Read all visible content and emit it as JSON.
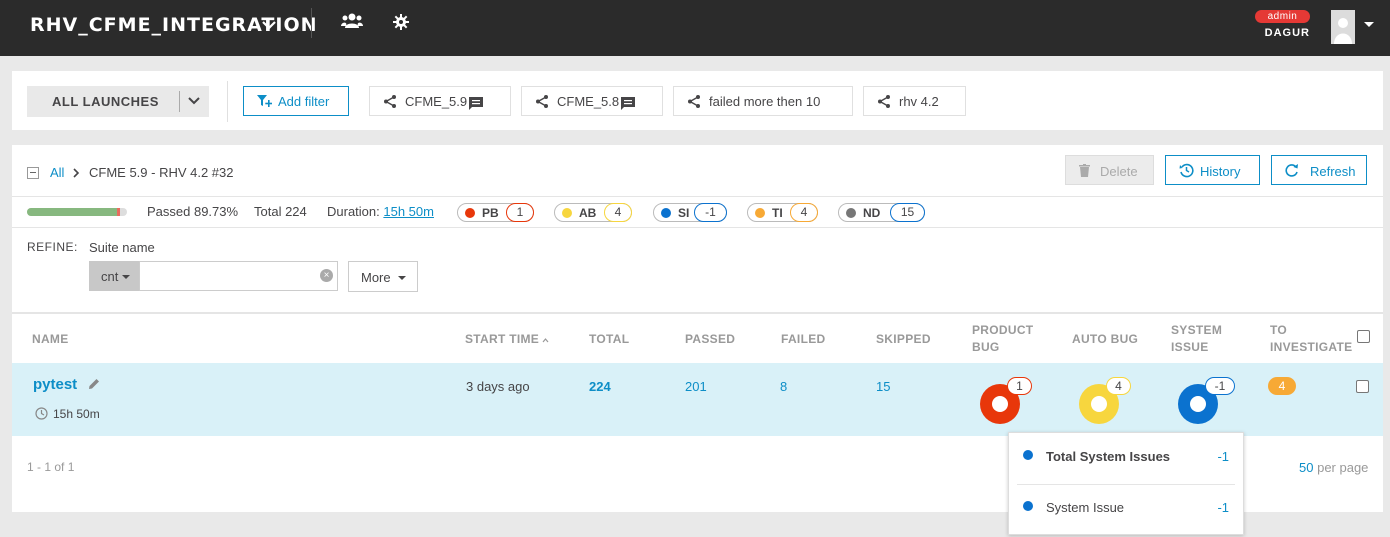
{
  "header": {
    "project": "RHV_CFME_INTEGRATION",
    "role": "admin",
    "username": "DAGUR"
  },
  "filterbar": {
    "all_launches": "ALL LAUNCHES",
    "add_filter": "Add filter",
    "filters": [
      {
        "label": "CFME_5.9",
        "comment": true
      },
      {
        "label": "CFME_5.8",
        "comment": true
      },
      {
        "label": "failed more then 10",
        "comment": false
      },
      {
        "label": "rhv 4.2",
        "comment": false
      }
    ]
  },
  "breadcrumb": {
    "all": "All",
    "current": "CFME 5.9 - RHV 4.2 #32"
  },
  "actions": {
    "delete": "Delete",
    "history": "History",
    "refresh": "Refresh"
  },
  "stats": {
    "passed": "Passed 89.73%",
    "passed_fraction": 0.8973,
    "total": "Total 224",
    "duration_label": "Duration:",
    "duration": "15h 50m",
    "defects": [
      {
        "code": "PB",
        "count": "1",
        "color": "#e8370a"
      },
      {
        "code": "AB",
        "count": "4",
        "color": "#f7d63e"
      },
      {
        "code": "SI",
        "count": "-1",
        "color": "#0b72cf"
      },
      {
        "code": "TI",
        "count": "4",
        "color": "#f7a935"
      },
      {
        "code": "ND",
        "count": "15",
        "color": "#777777"
      }
    ]
  },
  "refine": {
    "label": "REFINE:",
    "suite_name": "Suite name",
    "condition": "cnt",
    "value": "",
    "more": "More"
  },
  "table": {
    "columns": {
      "name": "NAME",
      "start_time": "START TIME",
      "total": "TOTAL",
      "passed": "PASSED",
      "failed": "FAILED",
      "skipped": "SKIPPED",
      "product_bug_1": "PRODUCT",
      "product_bug_2": "BUG",
      "auto_bug": "AUTO BUG",
      "system_issue_1": "SYSTEM",
      "system_issue_2": "ISSUE",
      "to_investigate_1": "TO",
      "to_investigate_2": "INVESTIGATE"
    },
    "row": {
      "name": "pytest",
      "duration": "15h 50m",
      "start_time": "3 days ago",
      "total": "224",
      "passed": "201",
      "failed": "8",
      "skipped": "15",
      "product_bug": "1",
      "auto_bug": "4",
      "system_issue": "-1",
      "to_investigate": "4"
    }
  },
  "pager": {
    "range": "1 - 1 of 1",
    "page_size": "50",
    "per_page": "per page"
  },
  "tooltip": {
    "total_label": "Total System Issues",
    "total_value": "-1",
    "item_label": "System Issue",
    "item_value": "-1"
  }
}
